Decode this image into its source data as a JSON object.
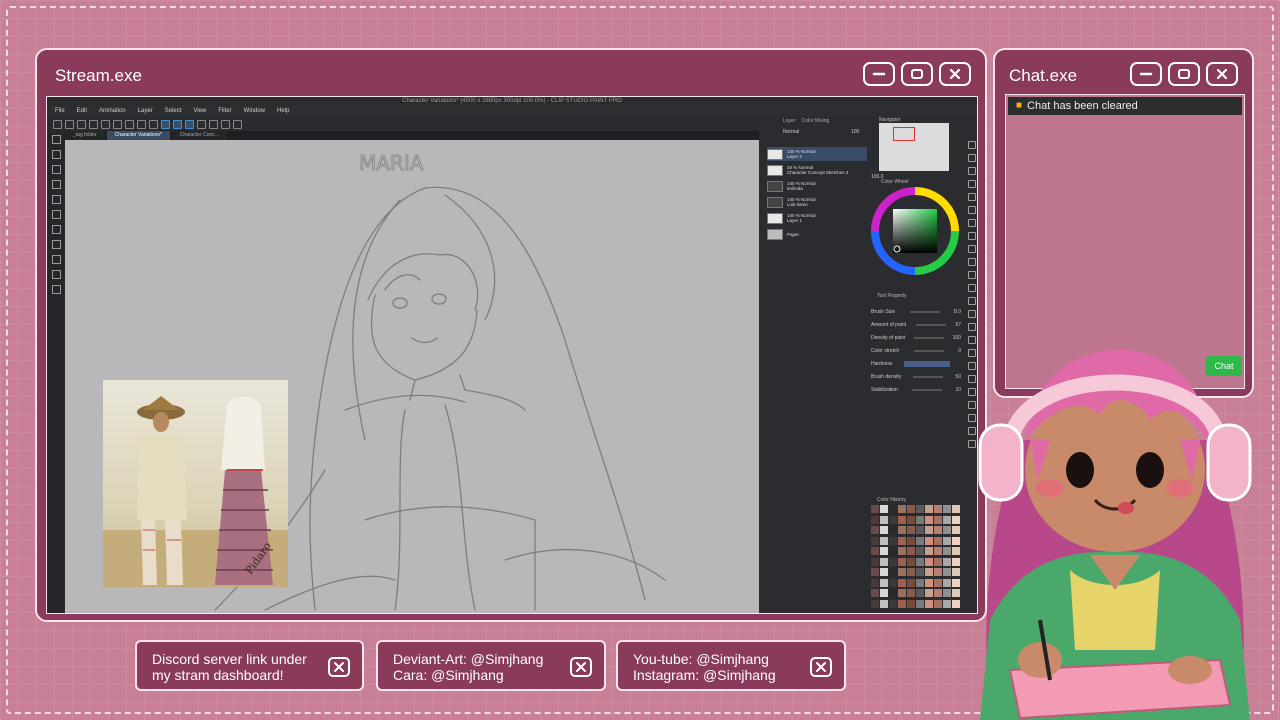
{
  "stream_window": {
    "title": "Stream.exe",
    "app": {
      "titlebar": "Character Variations* (4500 x 2880px 300dpi 100.0%) - CLIP STUDIO PAINT PRO",
      "menu": [
        "File",
        "Edit",
        "Animation",
        "Layer",
        "Select",
        "View",
        "Filter",
        "Window",
        "Help"
      ],
      "doc_tabs": [
        "_tag folder",
        "Character Variations*",
        "Character Conc..."
      ],
      "canvas_sketch_label": "MARIA",
      "panel_tabs": [
        "Layer",
        "Color Mixing"
      ],
      "blend_mode": "Normal",
      "opacity": "100",
      "layers": [
        {
          "line1": "100 % Normal",
          "line2": "Layer 2",
          "selected": true
        },
        {
          "line1": "20 % Normal",
          "line2": "Character Concept Sketches 3",
          "selected": false
        },
        {
          "line1": "100 % Normal",
          "line2": "Evilinda",
          "selected": false
        },
        {
          "line1": "100 % Normal",
          "line2": "Lola Ilame",
          "selected": false
        },
        {
          "line1": "100 % Normal",
          "line2": "Layer 1",
          "selected": false
        },
        {
          "line1": "",
          "line2": "Paper",
          "selected": false
        }
      ],
      "navigator_label": "Navigator",
      "zoom": "100.0",
      "color_wheel_label": "Color Wheel",
      "tool_property_label": "Tool Property",
      "properties": [
        {
          "name": "Brush Size",
          "value": "8.0"
        },
        {
          "name": "Amount of paint",
          "value": "57"
        },
        {
          "name": "Density of paint",
          "value": "100"
        },
        {
          "name": "Color stretch",
          "value": "0"
        },
        {
          "name": "Hardness",
          "value": ""
        },
        {
          "name": "Brush density",
          "value": "50"
        },
        {
          "name": "Stabilization",
          "value": "10"
        }
      ],
      "color_history_label": "Color History"
    }
  },
  "chat_window": {
    "title": "Chat.exe",
    "notice": "Chat has been cleared",
    "chat_button": "Chat"
  },
  "cards": [
    {
      "line1": "Discord server link under",
      "line2": "my stram dashboard!"
    },
    {
      "line1": "Deviant-Art: @Simjhang",
      "line2": "Cara: @Simjhang"
    },
    {
      "line1": "You-tube: @Simjhang",
      "line2": "Instagram: @Simjhang"
    }
  ],
  "colors": {
    "window_bg": "#8a3a5a",
    "page_bg": "#c98097",
    "border": "#f6e6ec",
    "chat_button": "#2eb84a"
  }
}
